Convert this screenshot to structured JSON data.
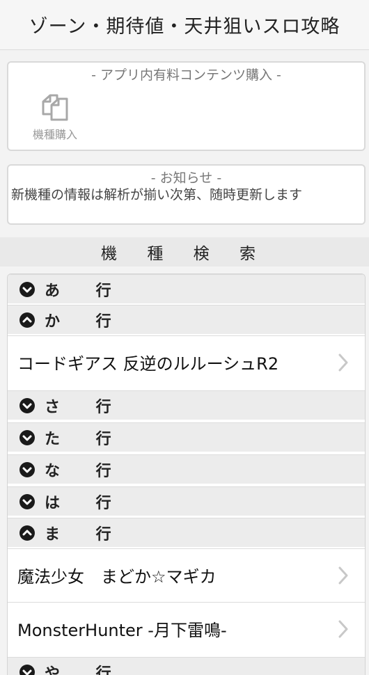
{
  "header": {
    "title": "ゾーン・期待値・天井狙いスロ攻略"
  },
  "purchase": {
    "title": "- アプリ内有料コンテンツ購入 -",
    "item_label": "機種購入",
    "item_icon": "copy-documents-icon"
  },
  "notice": {
    "title": "- お知らせ -",
    "text": "新機種の情報は解析が揃い次第、随時更新します"
  },
  "search": {
    "title": "機 種 検 索"
  },
  "list": {
    "groups": [
      {
        "label": "あ 行",
        "state": "collapsed"
      },
      {
        "label": "か 行",
        "state": "expanded"
      },
      {
        "label": "さ 行",
        "state": "collapsed"
      },
      {
        "label": "た 行",
        "state": "collapsed"
      },
      {
        "label": "な 行",
        "state": "collapsed"
      },
      {
        "label": "は 行",
        "state": "collapsed"
      },
      {
        "label": "ま 行",
        "state": "expanded"
      },
      {
        "label": "や 行",
        "state": "collapsed"
      }
    ],
    "items": [
      {
        "label": "コードギアス 反逆のルルーシュR2"
      },
      {
        "label": "魔法少女　まどか☆マギカ"
      },
      {
        "label": "MonsterHunter -月下雷鳴-"
      }
    ]
  },
  "colors": {
    "group_bg": "#ececec",
    "header_bg": "#f6f6f6",
    "chevron": "#c8c8c8"
  }
}
